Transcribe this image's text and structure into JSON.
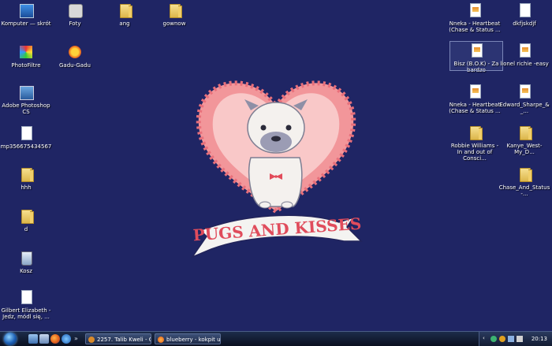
{
  "desktop": {
    "icons_left": [
      {
        "label": "Komputer — skrót"
      },
      {
        "label": "Foty"
      },
      {
        "label": "ang"
      },
      {
        "label": "gownow"
      },
      {
        "label": "PhotoFiltre"
      },
      {
        "label": "Gadu-Gadu"
      },
      {
        "label": "Adobe Photoshop CS"
      },
      {
        "label": "mp356675434567"
      },
      {
        "label": "hhh"
      },
      {
        "label": "d"
      },
      {
        "label": "Kosz"
      },
      {
        "label": "Gilbert Elizabeth - Jedz, módl się, ..."
      }
    ],
    "icons_right": [
      {
        "label": "Nneka - Heartbeat (Chase & Status ..."
      },
      {
        "label": "dkfjskdjf"
      },
      {
        "label": "Bisz (B.O.K) - Za bardzo"
      },
      {
        "label": "lionel richie -easy"
      },
      {
        "label": "Nneka - Heartbeat (Chase & Status ..."
      },
      {
        "label": "Edward_Sharpe_&_..."
      },
      {
        "label": "Robbie Williams - In and out of Consci..."
      },
      {
        "label": "Kanye_West-My_D..."
      },
      {
        "label": "Chase_And_Status-..."
      }
    ]
  },
  "wallpaper": {
    "banner_text": "PUGS AND KISSES"
  },
  "taskbar": {
    "tasks": [
      {
        "label": "2257. Talib Kweli - G..."
      },
      {
        "label": "blueberry - kokpit u..."
      }
    ],
    "clock": "20:13"
  }
}
